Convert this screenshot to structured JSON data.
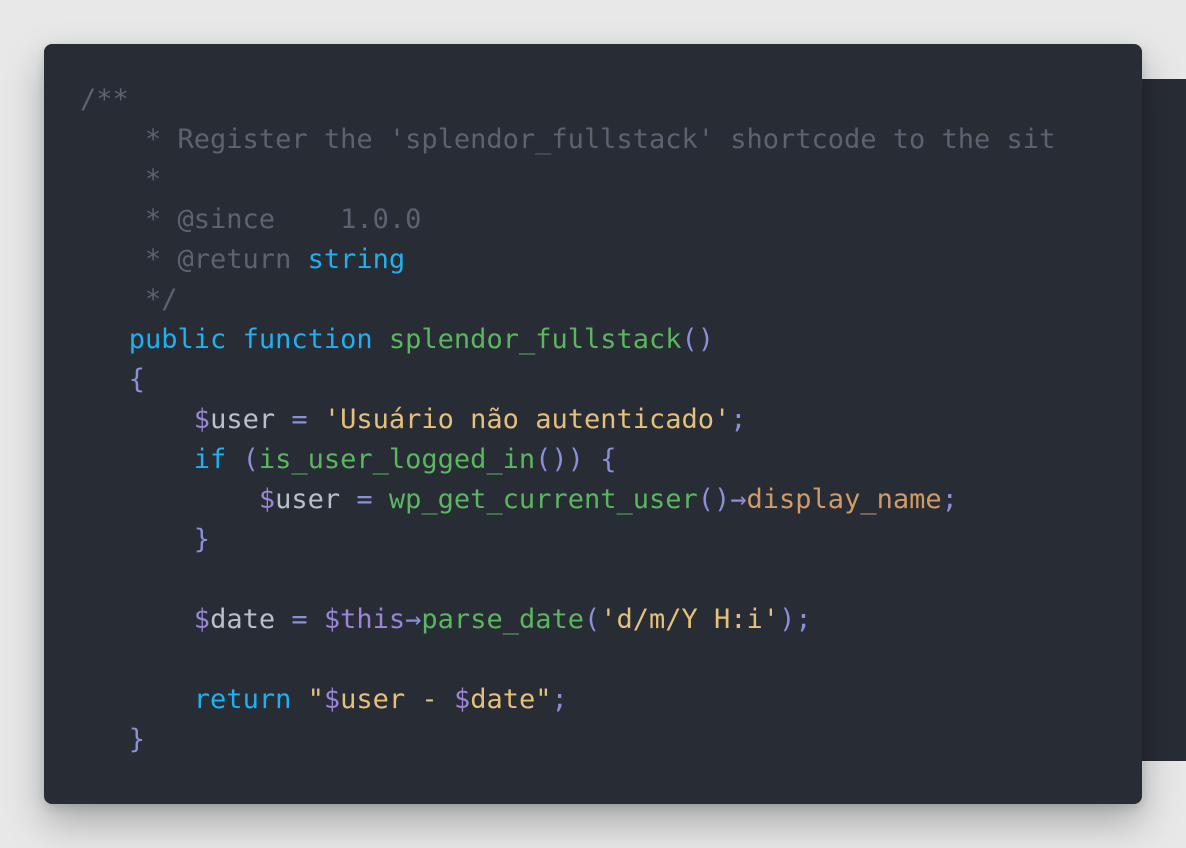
{
  "editor": {
    "language": "php",
    "theme": "dark",
    "colors": {
      "background": "#282c34",
      "comment": "#5c6370",
      "keyword": "#1fb0f0",
      "function": "#5ab65f",
      "string": "#e5c07b",
      "property": "#d19a66",
      "punctuation": "#8a8fd9"
    },
    "lines": [
      [
        {
          "t": "/**",
          "c": "comment"
        }
      ],
      [
        {
          "t": "    * Register the 'splendor_fullstack' shortcode to the sit",
          "c": "comment"
        }
      ],
      [
        {
          "t": "    *",
          "c": "comment"
        }
      ],
      [
        {
          "t": "    * @since    1.0.0",
          "c": "comment"
        }
      ],
      [
        {
          "t": "    * @return ",
          "c": "comment"
        },
        {
          "t": "string",
          "c": "keyword"
        }
      ],
      [
        {
          "t": "    */",
          "c": "comment"
        }
      ],
      [
        {
          "t": "   ",
          "c": "var"
        },
        {
          "t": "public",
          "c": "keyword"
        },
        {
          "t": " ",
          "c": "var"
        },
        {
          "t": "function",
          "c": "keyword"
        },
        {
          "t": " ",
          "c": "var"
        },
        {
          "t": "splendor_fullstack",
          "c": "func"
        },
        {
          "t": "()",
          "c": "punc"
        }
      ],
      [
        {
          "t": "   ",
          "c": "var"
        },
        {
          "t": "{",
          "c": "punc"
        }
      ],
      [
        {
          "t": "       ",
          "c": "var"
        },
        {
          "t": "$",
          "c": "sigil"
        },
        {
          "t": "user",
          "c": "var"
        },
        {
          "t": " = ",
          "c": "op"
        },
        {
          "t": "'Usuário não autenticado'",
          "c": "string"
        },
        {
          "t": ";",
          "c": "punc"
        }
      ],
      [
        {
          "t": "       ",
          "c": "var"
        },
        {
          "t": "if",
          "c": "keyword"
        },
        {
          "t": " (",
          "c": "punc"
        },
        {
          "t": "is_user_logged_in",
          "c": "func"
        },
        {
          "t": "()) {",
          "c": "punc"
        }
      ],
      [
        {
          "t": "           ",
          "c": "var"
        },
        {
          "t": "$",
          "c": "sigil"
        },
        {
          "t": "user",
          "c": "var"
        },
        {
          "t": " = ",
          "c": "op"
        },
        {
          "t": "wp_get_current_user",
          "c": "func"
        },
        {
          "t": "()",
          "c": "punc"
        },
        {
          "t": "→",
          "c": "op"
        },
        {
          "t": "display_name",
          "c": "prop"
        },
        {
          "t": ";",
          "c": "punc"
        }
      ],
      [
        {
          "t": "       ",
          "c": "var"
        },
        {
          "t": "}",
          "c": "punc"
        }
      ],
      [],
      [
        {
          "t": "       ",
          "c": "var"
        },
        {
          "t": "$",
          "c": "sigil"
        },
        {
          "t": "date",
          "c": "var"
        },
        {
          "t": " = ",
          "c": "op"
        },
        {
          "t": "$this",
          "c": "this"
        },
        {
          "t": "→",
          "c": "op"
        },
        {
          "t": "parse_date",
          "c": "func"
        },
        {
          "t": "(",
          "c": "punc"
        },
        {
          "t": "'d/m/Y H:i'",
          "c": "string"
        },
        {
          "t": ");",
          "c": "punc"
        }
      ],
      [],
      [
        {
          "t": "       ",
          "c": "var"
        },
        {
          "t": "return",
          "c": "keyword"
        },
        {
          "t": " ",
          "c": "var"
        },
        {
          "t": "\"",
          "c": "string"
        },
        {
          "t": "$",
          "c": "sigil"
        },
        {
          "t": "user",
          "c": "string"
        },
        {
          "t": " - ",
          "c": "string"
        },
        {
          "t": "$",
          "c": "sigil"
        },
        {
          "t": "date",
          "c": "string"
        },
        {
          "t": "\"",
          "c": "string"
        },
        {
          "t": ";",
          "c": "punc"
        }
      ],
      [
        {
          "t": "   ",
          "c": "var"
        },
        {
          "t": "}",
          "c": "punc"
        }
      ]
    ]
  }
}
